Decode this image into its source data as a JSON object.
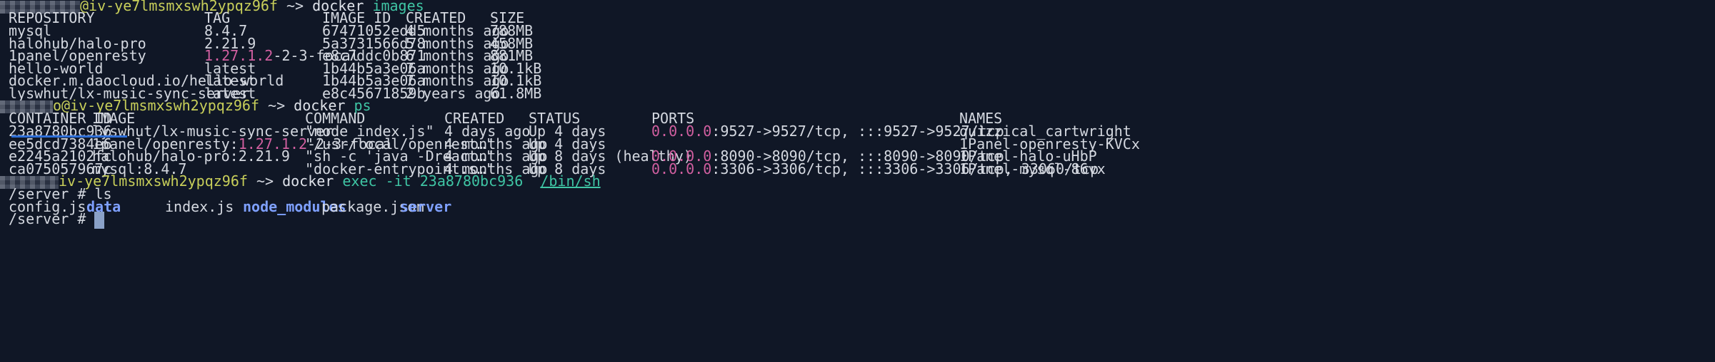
{
  "prompt": {
    "user": "@iv-ye7lmsmxswh2ypqz96f",
    "user2": "o@iv-ye7lmsmxswh2ypqz96f",
    "user3": "iv-ye7lmsmxswh2ypqz96f",
    "sep": " ~> ",
    "shell": "/server # "
  },
  "cmd_images": {
    "cmd": "docker",
    "arg": "images"
  },
  "images": {
    "headers": [
      "REPOSITORY",
      "TAG",
      "IMAGE ID",
      "CREATED",
      "SIZE"
    ],
    "rows": [
      {
        "repo": "mysql",
        "tag_a": "8.4.7",
        "tag_b": "",
        "id": "67471052edd5",
        "created": "4 months ago",
        "size": "788MB"
      },
      {
        "repo": "halohub/halo-pro",
        "tag_a": "2.21.9",
        "tag_b": "",
        "id": "5a3731566d78",
        "created": "5 months ago",
        "size": "458MB"
      },
      {
        "repo": "1panel/openresty",
        "tag_a": "1.27.1.2",
        "tag_b": "-2-3-focal",
        "id": "e8c7ddc0b871",
        "created": "6 months ago",
        "size": "881MB"
      },
      {
        "repo": "hello-world",
        "tag_a": "latest",
        "tag_b": "",
        "id": "1b44b5a3e06a",
        "created": "7 months ago",
        "size": "10.1kB"
      },
      {
        "repo": "docker.m.daocloud.io/hello-world",
        "tag_a": "latest",
        "tag_b": "",
        "id": "1b44b5a3e06a",
        "created": "7 months ago",
        "size": "10.1kB"
      },
      {
        "repo": "lyswhut/lx-music-sync-server",
        "tag_a": "latest",
        "tag_b": "",
        "id": "e8c45671859b",
        "created": "2 years ago",
        "size": "61.8MB"
      }
    ]
  },
  "cmd_ps": {
    "cmd": "docker",
    "arg": "ps"
  },
  "containers": {
    "headers": [
      "CONTAINER ID",
      "IMAGE",
      "COMMAND",
      "CREATED",
      "STATUS",
      "PORTS",
      "NAMES"
    ],
    "rows": [
      {
        "id": "23a8780bc936",
        "image_a": "lyswhut/lx-music-sync-server",
        "image_b": "",
        "image_c": "",
        "command": "\"node index.js\"",
        "created": "4 days ago",
        "status": "Up 4 days",
        "port_ip": "0.0.0.0",
        "ports": ":9527->9527/tcp, :::9527->9527/tcp",
        "name": "quizzical_cartwright"
      },
      {
        "id": "ee5dcd7384e6",
        "image_a": "1panel/openresty:",
        "image_b": "1.27.1.2",
        "image_c": "-2-3-focal",
        "command": "\"/usr/local/openrest…\"",
        "created": "4 months ago",
        "status": "Up 4 days",
        "port_ip": "",
        "ports": "",
        "name": "1Panel-openresty-KVCx"
      },
      {
        "id": "e2245a2102fc",
        "image_a": "halohub/halo-pro:2.21.9",
        "image_b": "",
        "image_c": "",
        "command": "\"sh -c 'java -Dreact…\"",
        "created": "4 months ago",
        "status": "Up 8 days (healthy)",
        "port_ip": "0.0.0.0",
        "ports": ":8090->8090/tcp, :::8090->8090/tcp",
        "name": "1Panel-halo-uHbP"
      },
      {
        "id": "ca075057967c",
        "image_a": "mysql:8.4.7",
        "image_b": "",
        "image_c": "",
        "command": "\"docker-entrypoint.s…\"",
        "created": "4 months ago",
        "status": "Up 8 days",
        "port_ip": "0.0.0.0",
        "ports": ":3306->3306/tcp, :::3306->3306/tcp, 33060/tcp",
        "name": "1Panel-mysql-86vx"
      }
    ]
  },
  "cmd_exec": {
    "cmd": "docker",
    "arg1": "exec -it 23a8780bc936",
    "arg2": "/bin/sh"
  },
  "cmd_ls": "ls",
  "ls_output": [
    {
      "name": "config.js",
      "dir": false
    },
    {
      "name": "data",
      "dir": true
    },
    {
      "name": "index.js",
      "dir": false
    },
    {
      "name": "node_modules",
      "dir": true
    },
    {
      "name": "package.json",
      "dir": false
    },
    {
      "name": "server",
      "dir": true
    }
  ],
  "colors": {
    "background": "#101726",
    "text": "#d4d8e0",
    "user": "#c8cf5a",
    "argument": "#3fc5a4",
    "ip_highlight": "#d15fa0",
    "directory": "#7ea0ff"
  }
}
